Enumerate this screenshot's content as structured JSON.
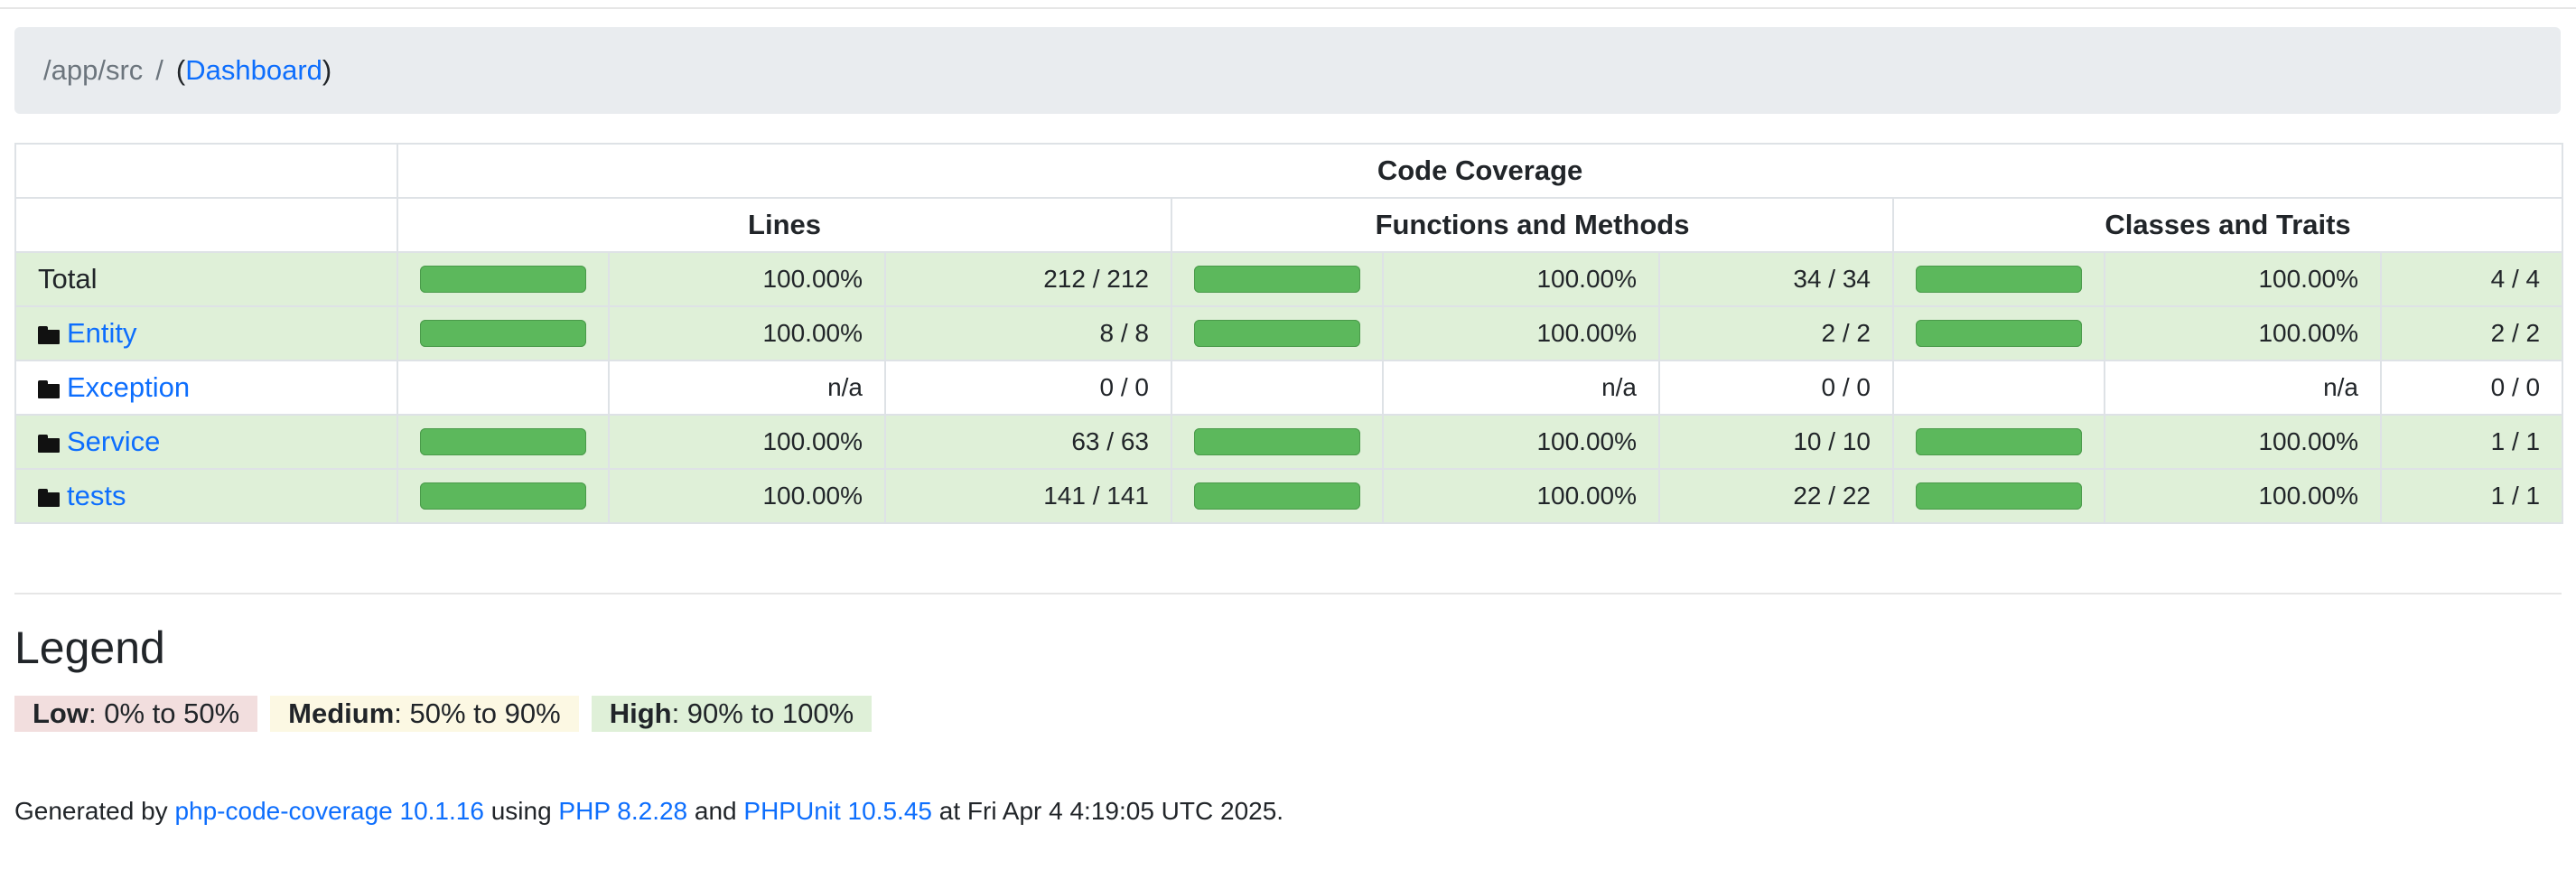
{
  "breadcrumb": {
    "path": "/app/src",
    "separator": "/",
    "dashboard_link": "Dashboard"
  },
  "table": {
    "header": "Code Coverage",
    "groups": [
      "Lines",
      "Functions and Methods",
      "Classes and Traits"
    ],
    "rows": [
      {
        "name": "Total",
        "is_folder": false,
        "level": "high",
        "lines": {
          "pct": "100.00%",
          "count": "212 / 212",
          "bar_fraction": 1.0
        },
        "functions": {
          "pct": "100.00%",
          "count": "34 / 34",
          "bar_fraction": 1.0
        },
        "classes": {
          "pct": "100.00%",
          "count": "4 / 4",
          "bar_fraction": 1.0
        }
      },
      {
        "name": "Entity",
        "is_folder": true,
        "level": "high",
        "lines": {
          "pct": "100.00%",
          "count": "8 / 8",
          "bar_fraction": 1.0
        },
        "functions": {
          "pct": "100.00%",
          "count": "2 / 2",
          "bar_fraction": 1.0
        },
        "classes": {
          "pct": "100.00%",
          "count": "2 / 2",
          "bar_fraction": 1.0
        }
      },
      {
        "name": "Exception",
        "is_folder": true,
        "level": "none",
        "lines": {
          "pct": "n/a",
          "count": "0 / 0",
          "bar_fraction": 0
        },
        "functions": {
          "pct": "n/a",
          "count": "0 / 0",
          "bar_fraction": 0
        },
        "classes": {
          "pct": "n/a",
          "count": "0 / 0",
          "bar_fraction": 0
        }
      },
      {
        "name": "Service",
        "is_folder": true,
        "level": "high",
        "lines": {
          "pct": "100.00%",
          "count": "63 / 63",
          "bar_fraction": 1.0
        },
        "functions": {
          "pct": "100.00%",
          "count": "10 / 10",
          "bar_fraction": 1.0
        },
        "classes": {
          "pct": "100.00%",
          "count": "1 / 1",
          "bar_fraction": 1.0
        }
      },
      {
        "name": "tests",
        "is_folder": true,
        "level": "high",
        "lines": {
          "pct": "100.00%",
          "count": "141 / 141",
          "bar_fraction": 1.0
        },
        "functions": {
          "pct": "100.00%",
          "count": "22 / 22",
          "bar_fraction": 1.0
        },
        "classes": {
          "pct": "100.00%",
          "count": "1 / 1",
          "bar_fraction": 1.0
        }
      }
    ]
  },
  "legend": {
    "title": "Legend",
    "low": {
      "label": "Low",
      "range": ": 0% to 50%"
    },
    "medium": {
      "label": "Medium",
      "range": ": 50% to 90%"
    },
    "high": {
      "label": "High",
      "range": ": 90% to 100%"
    }
  },
  "footer": {
    "prefix": "Generated by ",
    "tool_link": "php-code-coverage 10.1.16",
    "using": " using ",
    "php_link": "PHP 8.2.28",
    "and": " and ",
    "phpunit_link": "PHPUnit 10.5.45",
    "suffix": " at Fri Apr 4 4:19:05 UTC 2025."
  },
  "colors": {
    "bar_success": "#5cb85c",
    "row_high": "#dff0d8",
    "legend_low": "#f2dede",
    "legend_medium": "#fcf8e3",
    "link": "#0d6efd"
  },
  "icons": {
    "folder": "folder-icon"
  }
}
